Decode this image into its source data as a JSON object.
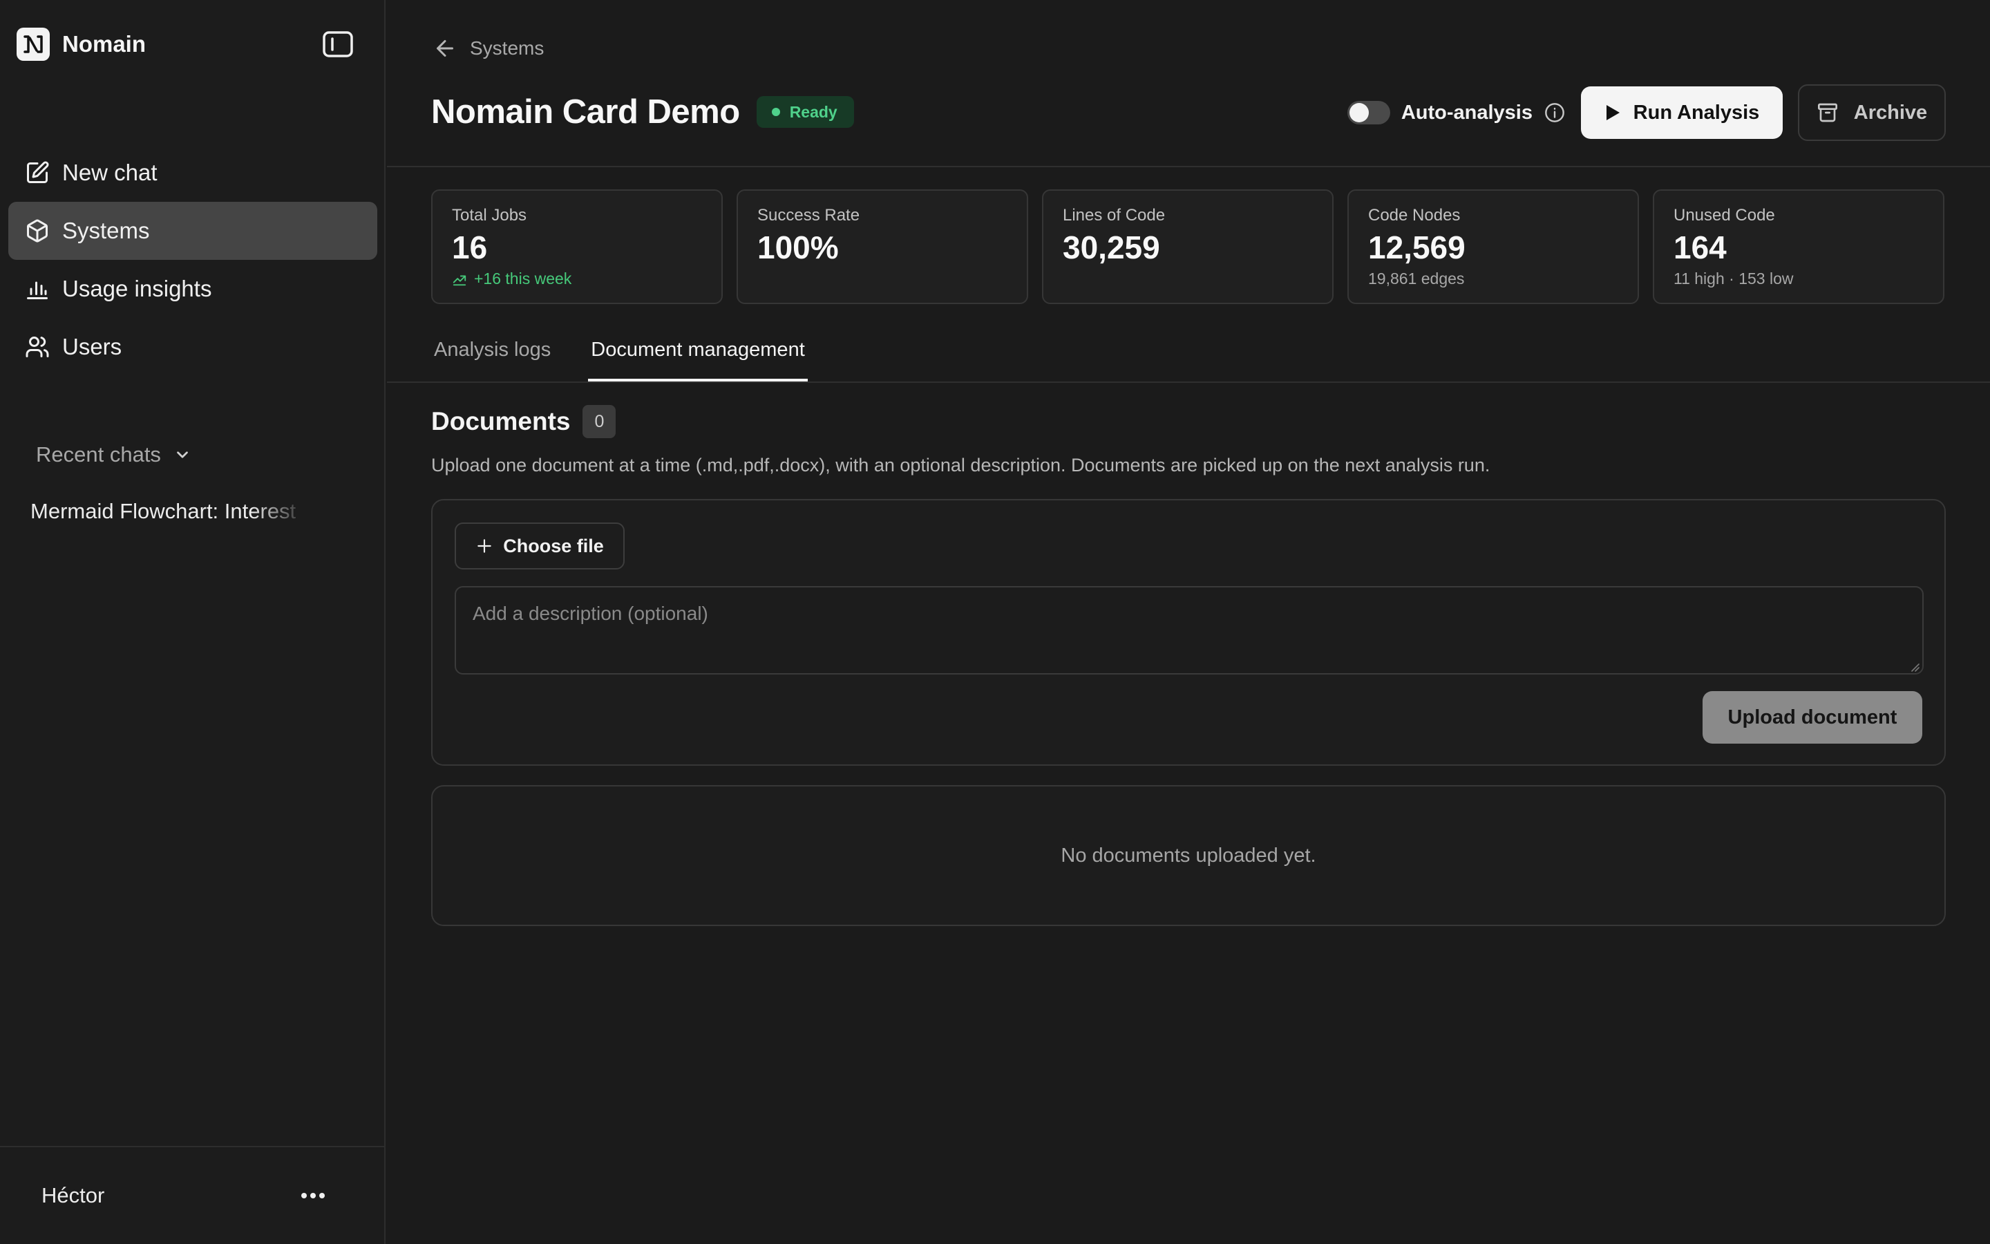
{
  "app": {
    "name": "Nomain"
  },
  "sidebar": {
    "items": [
      {
        "label": "New chat",
        "icon": "edit-icon"
      },
      {
        "label": "Systems",
        "icon": "cube-icon",
        "active": true
      },
      {
        "label": "Usage insights",
        "icon": "bar-chart-icon"
      },
      {
        "label": "Users",
        "icon": "users-icon"
      }
    ],
    "recent_chats_label": "Recent chats",
    "recent_chats": [
      "Mermaid Flowchart: Interest"
    ],
    "user": "Héctor"
  },
  "breadcrumb": {
    "label": "Systems"
  },
  "header": {
    "title": "Nomain Card Demo",
    "status": "Ready",
    "status_color": "#4fd18b",
    "auto_analysis_label": "Auto-analysis",
    "auto_analysis_enabled": false,
    "run_label": "Run Analysis",
    "archive_label": "Archive"
  },
  "stats": [
    {
      "label": "Total Jobs",
      "value": "16",
      "sub": "+16 this week"
    },
    {
      "label": "Success Rate",
      "value": "100%",
      "sub": ""
    },
    {
      "label": "Lines of Code",
      "value": "30,259",
      "sub": ""
    },
    {
      "label": "Code Nodes",
      "value": "12,569",
      "sub": "19,861 edges"
    },
    {
      "label": "Unused Code",
      "value": "164",
      "sub": "11 high · 153 low"
    }
  ],
  "tabs": [
    {
      "label": "Analysis logs"
    },
    {
      "label": "Document management",
      "active": true
    }
  ],
  "documents": {
    "title": "Documents",
    "count": "0",
    "description": "Upload one document at a time (.md,.pdf,.docx), with an optional description. Documents are picked up on the next analysis run.",
    "choose_label": "Choose file",
    "description_placeholder": "Add a description (optional)",
    "description_value": "",
    "upload_label": "Upload document",
    "empty_text": "No documents uploaded yet."
  }
}
